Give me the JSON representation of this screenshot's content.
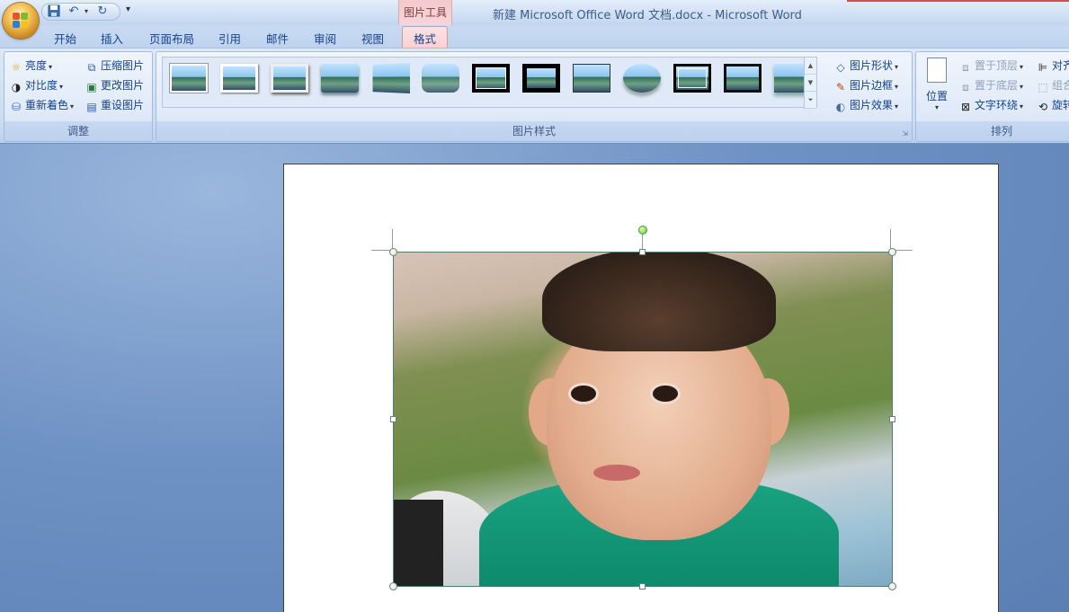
{
  "window": {
    "title": "新建 Microsoft Office Word 文档.docx - Microsoft Word",
    "contextual_tab_group": "图片工具"
  },
  "quick_access": {
    "save_icon": "save-icon",
    "undo_icon": "undo-icon",
    "redo_icon": "redo-icon",
    "customize_icon": "customize-qat-icon"
  },
  "tabs": [
    {
      "label": "开始"
    },
    {
      "label": "插入"
    },
    {
      "label": "页面布局"
    },
    {
      "label": "引用"
    },
    {
      "label": "邮件"
    },
    {
      "label": "审阅"
    },
    {
      "label": "视图"
    },
    {
      "label": "格式",
      "active": true
    }
  ],
  "ribbon": {
    "adjust": {
      "label": "调整",
      "brightness": "亮度",
      "contrast": "对比度",
      "recolor": "重新着色",
      "compress": "压缩图片",
      "change_picture": "更改图片",
      "reset_picture": "重设图片"
    },
    "styles": {
      "label": "图片样式",
      "shape": "图片形状",
      "border": "图片边框",
      "effects": "图片效果",
      "gallery_count": 13
    },
    "arrange": {
      "label": "排列",
      "position": "位置",
      "bring_front": "置于顶层",
      "send_back": "置于底层",
      "text_wrap": "文字环绕",
      "align": "对齐",
      "group": "组合",
      "rotate": "旋转"
    }
  },
  "colors": {
    "ribbon_bg": "#dde8f7",
    "contextual_tab": "#f7d0d0",
    "document_bg": "#6f92c4",
    "text": "#15428b"
  }
}
